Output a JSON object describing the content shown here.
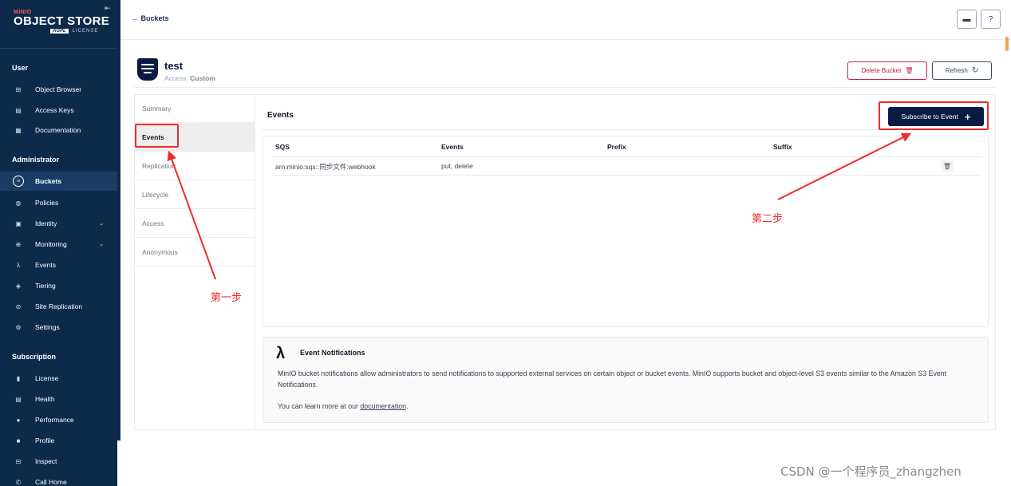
{
  "sidebar": {
    "logo_brand": "MINIO",
    "logo_title": "OBJECT STORE",
    "logo_agpl": "AGPL",
    "logo_license": "LICENSE",
    "collapse_icon": "⇤",
    "section_user": "User",
    "section_admin": "Administrator",
    "section_subscription": "Subscription",
    "user_items": [
      {
        "label": "Object Browser",
        "icon": "⊞"
      },
      {
        "label": "Access Keys",
        "icon": "▤"
      },
      {
        "label": "Documentation",
        "icon": "▦"
      }
    ],
    "admin_items": [
      {
        "label": "Buckets",
        "icon": "≡"
      },
      {
        "label": "Policies",
        "icon": "◍"
      },
      {
        "label": "Identity",
        "icon": "▣"
      },
      {
        "label": "Monitoring",
        "icon": "⊕"
      },
      {
        "label": "Events",
        "icon": "λ"
      },
      {
        "label": "Tiering",
        "icon": "◈"
      },
      {
        "label": "Site Replication",
        "icon": "⊘"
      },
      {
        "label": "Settings",
        "icon": "⚙"
      }
    ],
    "sub_items": [
      {
        "label": "License",
        "icon": "▮"
      },
      {
        "label": "Health",
        "icon": "▤"
      },
      {
        "label": "Performance",
        "icon": "●"
      },
      {
        "label": "Profile",
        "icon": "■"
      },
      {
        "label": "Inspect",
        "icon": "⊟"
      },
      {
        "label": "Call Home",
        "icon": "✆"
      }
    ]
  },
  "topbar": {
    "back_label": "← Buckets",
    "folder_icon": "▬",
    "help_icon": "?"
  },
  "bucket": {
    "name": "test",
    "access_label": "Access:",
    "access_value": "Custom",
    "delete_label": "Delete Bucket",
    "delete_icon": "🗑",
    "refresh_label": "Refresh",
    "refresh_icon": "↻"
  },
  "tabs": [
    "Summary",
    "Events",
    "Replication",
    "Lifecycle",
    "Access",
    "Anonymous"
  ],
  "events": {
    "title": "Events",
    "subscribe_label": "Subscribe to Event",
    "subscribe_icon": "+",
    "columns": [
      "SQS",
      "Events",
      "Prefix",
      "Suffix"
    ],
    "rows": [
      {
        "sqs": "arn:minio:sqs::同步文件:webhook",
        "events": "put, delete",
        "prefix": "",
        "suffix": ""
      }
    ],
    "row_delete_icon": "🗑"
  },
  "info": {
    "icon": "λ",
    "title": "Event Notifications",
    "p1": "MinIO bucket notifications allow administrators to send notifications to supported external services on certain object or bucket events. MinIO supports bucket and object-level S3 events similar to the Amazon S3 Event Notifications.",
    "p2_prefix": "You can learn more at our ",
    "p2_link": "documentation",
    "p2_suffix": "."
  },
  "annotations": {
    "step1": "第一步",
    "step2": "第二步",
    "color": "#f02a2a"
  },
  "watermark": "CSDN @一个程序员_zhangzhen"
}
